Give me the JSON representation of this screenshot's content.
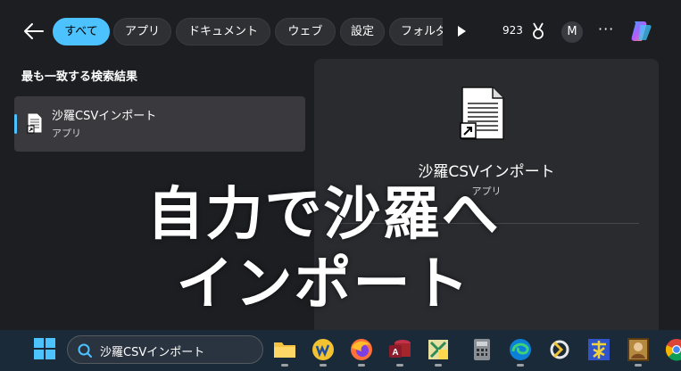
{
  "filters": {
    "back_label": "←",
    "all": "すべて",
    "apps": "アプリ",
    "documents": "ドキュメント",
    "web": "ウェブ",
    "settings": "設定",
    "folders": "フォルダ"
  },
  "header": {
    "points": "923",
    "avatar_initial": "M",
    "more": "···"
  },
  "best_match": {
    "title": "最も一致する検索結果",
    "item_name": "沙羅CSVインポート",
    "item_type": "アプリ"
  },
  "detail": {
    "name": "沙羅CSVインポート",
    "type": "アプリ"
  },
  "overlay": {
    "line1": "自力で沙羅へ",
    "line2": "インポート"
  },
  "taskbar": {
    "search_value": "沙羅CSVインポート",
    "apps": [
      "file-explorer",
      "iw-app",
      "firefox",
      "access",
      "excel-vba",
      "calculator",
      "edge",
      "app-arrow",
      "kanji-app",
      "portrait-app",
      "chrome"
    ]
  },
  "colors": {
    "accent": "#4cc2ff",
    "background": "#1d1e22",
    "taskbar": "#1b2a38"
  }
}
